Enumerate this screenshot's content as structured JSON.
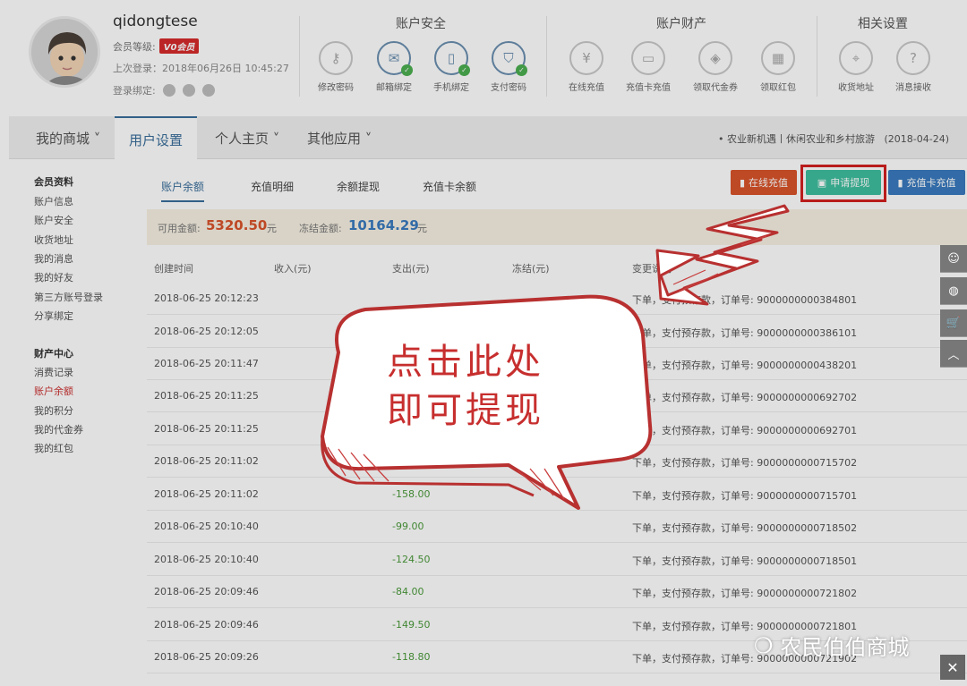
{
  "user": {
    "name": "qidongtese",
    "level_label": "会员等级:",
    "vip": "V0会员",
    "last_login": "上次登录：2018年06月26日 10:45:27",
    "bind_label": "登录绑定:"
  },
  "groups": [
    {
      "title": "账户安全"
    },
    {
      "title": "账户财产"
    },
    {
      "title": "相关设置"
    }
  ],
  "header_icons": [
    {
      "label": "修改密码",
      "icon": "key-icon"
    },
    {
      "label": "邮箱绑定",
      "icon": "mail-icon"
    },
    {
      "label": "手机绑定",
      "icon": "phone-icon"
    },
    {
      "label": "支付密码",
      "icon": "shield-icon"
    },
    {
      "label": "在线充值",
      "icon": "money-bag-icon"
    },
    {
      "label": "充值卡充值",
      "icon": "card-icon"
    },
    {
      "label": "领取代金券",
      "icon": "coupon-icon"
    },
    {
      "label": "领取红包",
      "icon": "red-packet-icon"
    },
    {
      "label": "收货地址",
      "icon": "location-icon"
    },
    {
      "label": "消息接收",
      "icon": "message-icon"
    }
  ],
  "nav": {
    "items": [
      "我的商城",
      "用户设置",
      "个人主页",
      "其他应用"
    ],
    "news": "• 农业新机遇丨休闲农业和乡村旅游",
    "news_date": "(2018-04-24)"
  },
  "sidebar": {
    "section1": "会员资料",
    "items1": [
      "账户信息",
      "账户安全",
      "收货地址",
      "我的消息",
      "我的好友",
      "第三方账号登录",
      "分享绑定"
    ],
    "section2": "财产中心",
    "items2": [
      "消费记录",
      "账户余额",
      "我的积分",
      "我的代金券",
      "我的红包"
    ]
  },
  "tabs": [
    "账户余额",
    "充值明细",
    "余额提现",
    "充值卡余额"
  ],
  "buttons": {
    "online": "在线充值",
    "withdraw": "申请提现",
    "card": "充值卡充值"
  },
  "balance": {
    "available_label": "可用金额:",
    "available": "5320.50",
    "frozen_label": "冻结金额:",
    "frozen": "10164.29",
    "unit": "元"
  },
  "table": {
    "headers": [
      "创建时间",
      "收入(元)",
      "支出(元)",
      "冻结(元)",
      "变更说明"
    ],
    "rows": [
      {
        "date": "2018-06-25 20:12:23",
        "out": "",
        "remark": "下单，支付预存款，订单号: 9000000000384801"
      },
      {
        "date": "2018-06-25 20:12:05",
        "out": "",
        "remark": "下单，支付预存款，订单号: 9000000000386101"
      },
      {
        "date": "2018-06-25 20:11:47",
        "out": "",
        "remark": "下单，支付预存款，订单号: 9000000000438201"
      },
      {
        "date": "2018-06-25 20:11:25",
        "out": "",
        "remark": "下单，支付预存款，订单号: 9000000000692702"
      },
      {
        "date": "2018-06-25 20:11:25",
        "out": "",
        "remark": "下单，支付预存款，订单号: 9000000000692701"
      },
      {
        "date": "2018-06-25 20:11:02",
        "out": "",
        "remark": "下单，支付预存款，订单号: 9000000000715702"
      },
      {
        "date": "2018-06-25 20:11:02",
        "out": "-158.00",
        "remark": "下单，支付预存款，订单号: 9000000000715701"
      },
      {
        "date": "2018-06-25 20:10:40",
        "out": "-99.00",
        "remark": "下单，支付预存款，订单号: 9000000000718502"
      },
      {
        "date": "2018-06-25 20:10:40",
        "out": "-124.50",
        "remark": "下单，支付预存款，订单号: 9000000000718501"
      },
      {
        "date": "2018-06-25 20:09:46",
        "out": "-84.00",
        "remark": "下单，支付预存款，订单号: 9000000000721802"
      },
      {
        "date": "2018-06-25 20:09:46",
        "out": "-149.50",
        "remark": "下单，支付预存款，订单号: 9000000000721801"
      },
      {
        "date": "2018-06-25 20:09:26",
        "out": "-118.80",
        "remark": "下单，支付预存款，订单号: 9000000000721902"
      }
    ]
  },
  "callout": {
    "line1": "点击此处",
    "line2": "即可提现"
  },
  "watermark": "农民伯伯商城",
  "colors": {
    "accent": "#3a6e9a",
    "withdraw_button": "#3fbf9f",
    "online_button": "#d9542b",
    "card_button": "#3a7abf",
    "highlight": "#d32020"
  }
}
